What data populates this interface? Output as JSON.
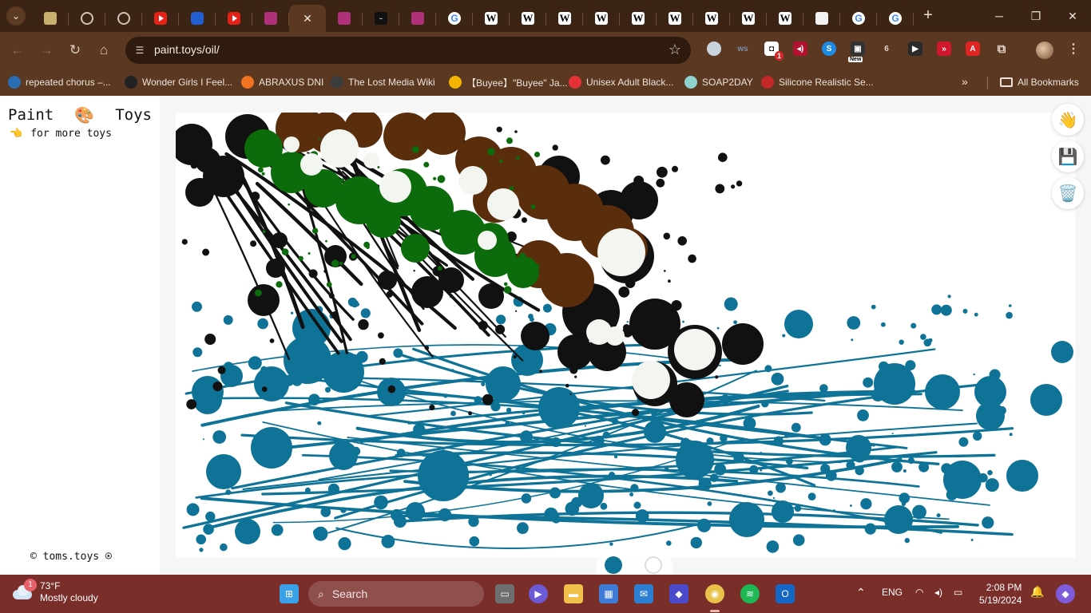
{
  "browser": {
    "tabs": [
      {
        "icon": "khan-icon",
        "cls": "kh",
        "glyph": ""
      },
      {
        "icon": "globe-icon",
        "cls": "globe",
        "glyph": ""
      },
      {
        "icon": "globe-icon",
        "cls": "globe",
        "glyph": ""
      },
      {
        "icon": "youtube-icon",
        "cls": "yt",
        "glyph": ""
      },
      {
        "icon": "teams-icon",
        "cls": "tt",
        "glyph": ""
      },
      {
        "icon": "youtube-icon",
        "cls": "yt",
        "glyph": ""
      },
      {
        "icon": "pink-app-icon",
        "cls": "pink",
        "glyph": ""
      },
      {
        "icon": "close-icon",
        "cls": "active",
        "glyph": "✕"
      },
      {
        "icon": "pink-app-icon",
        "cls": "pink",
        "glyph": ""
      },
      {
        "icon": "dark-site-icon",
        "cls": "dark",
        "glyph": "~"
      },
      {
        "icon": "pink-app-icon",
        "cls": "pink",
        "glyph": ""
      },
      {
        "icon": "google-icon",
        "cls": "g",
        "glyph": "G"
      },
      {
        "icon": "wikipedia-icon",
        "cls": "wiki",
        "glyph": "W"
      },
      {
        "icon": "wikipedia-icon",
        "cls": "wiki",
        "glyph": "W"
      },
      {
        "icon": "wikipedia-icon",
        "cls": "wiki",
        "glyph": "W"
      },
      {
        "icon": "wikipedia-icon",
        "cls": "wiki",
        "glyph": "W"
      },
      {
        "icon": "wikipedia-icon",
        "cls": "wiki",
        "glyph": "W"
      },
      {
        "icon": "wikipedia-icon",
        "cls": "wiki",
        "glyph": "W"
      },
      {
        "icon": "wikipedia-icon",
        "cls": "wiki",
        "glyph": "W"
      },
      {
        "icon": "wikipedia-icon",
        "cls": "wiki",
        "glyph": "W"
      },
      {
        "icon": "wikipedia-icon",
        "cls": "wiki",
        "glyph": "W"
      },
      {
        "icon": "blank-page-icon",
        "cls": "blank",
        "glyph": ""
      },
      {
        "icon": "google-icon",
        "cls": "g",
        "glyph": "G"
      },
      {
        "icon": "google-icon",
        "cls": "g",
        "glyph": "G"
      }
    ],
    "url": "paint.toys/oil/",
    "extensions_badge": "1",
    "extensions_new_label": "New",
    "extension_6_label": "6"
  },
  "bookmarks": [
    {
      "label": "repeated chorus –...",
      "color": "#2a6db3"
    },
    {
      "label": "Wonder Girls I Feel...",
      "color": "#222222"
    },
    {
      "label": "ABRAXUS DNI",
      "color": "#f27321"
    },
    {
      "label": "The Lost Media Wiki",
      "color": "#3c3c3c"
    },
    {
      "label": "【Buyee】\"Buyee\" Ja...",
      "color": "#f4b400"
    },
    {
      "label": "Unisex Adult Black...",
      "color": "#e53238"
    },
    {
      "label": "SOAP2DAY",
      "color": "#8fd3d1"
    },
    {
      "label": "Silicone Realistic Se...",
      "color": "#c62828"
    }
  ],
  "bookmarks_overflow": "»",
  "all_bookmarks": "All Bookmarks",
  "app": {
    "brand_left": "Paint",
    "brand_right": "Toys",
    "brand_icon": "🎨",
    "more_icon": "👈",
    "more_label": "for more toys",
    "copyright": "© toms.toys ⍟",
    "hand_icon": "👋",
    "save_icon": "💾",
    "trash_icon": "🗑️",
    "colors": {
      "blue": "#0e7396",
      "black": "#111111",
      "brown": "#5a2d0c",
      "green": "#0c6b0a",
      "white": "#f2f5f0"
    },
    "swatches": [
      "#0e7396",
      "#ffffff"
    ]
  },
  "taskbar": {
    "weather_badge": "1",
    "temp": "73°F",
    "condition": "Mostly cloudy",
    "search_label": "Search",
    "lang": "ENG",
    "time": "2:08 PM",
    "date": "5/19/2024"
  }
}
